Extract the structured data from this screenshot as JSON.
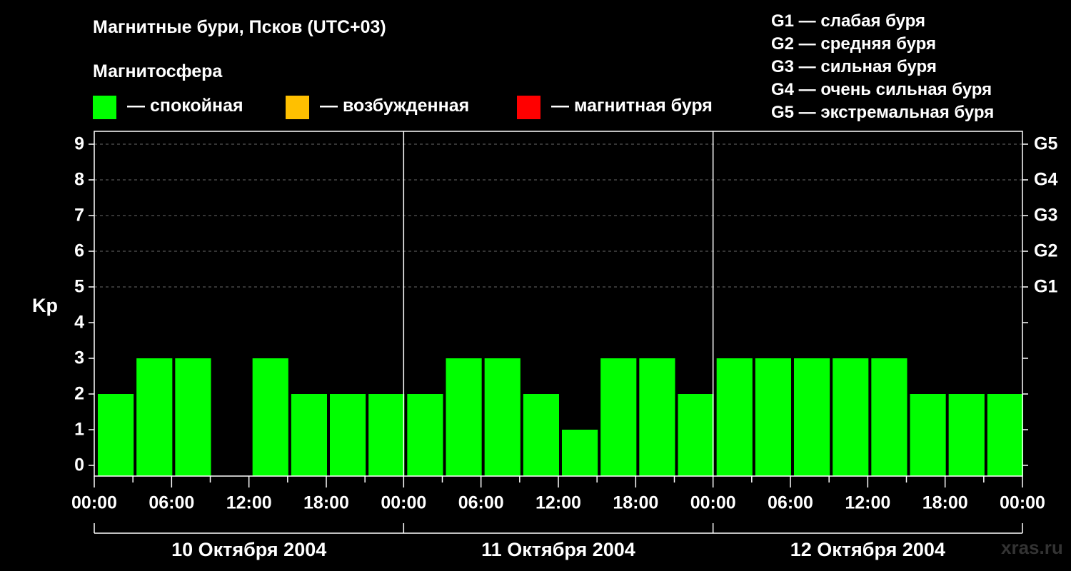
{
  "header": {
    "title": "Магнитные бури, Псков (UTC+03)",
    "subtitle": "Магнитосфера"
  },
  "legend": [
    {
      "color": "#00ff00",
      "label": "— спокойная"
    },
    {
      "color": "#ffc000",
      "label": "— возбужденная"
    },
    {
      "color": "#ff0000",
      "label": "— магнитная буря"
    }
  ],
  "storm_scale": [
    "G1 — слабая буря",
    "G2 — средняя буря",
    "G3 — сильная буря",
    "G4 — очень сильная буря",
    "G5 — экстремальная буря"
  ],
  "credit": "xras.ru",
  "chart_data": {
    "type": "bar",
    "title": "Магнитные бури, Псков (UTC+03)",
    "ylabel": "Kp",
    "ylim": [
      0,
      9
    ],
    "yticks": [
      "0",
      "1",
      "2",
      "3",
      "4",
      "5",
      "6",
      "7",
      "8",
      "9"
    ],
    "right_axis_labels": [
      {
        "kp": 5,
        "label": "G1"
      },
      {
        "kp": 6,
        "label": "G2"
      },
      {
        "kp": 7,
        "label": "G3"
      },
      {
        "kp": 8,
        "label": "G4"
      },
      {
        "kp": 9,
        "label": "G5"
      }
    ],
    "x_tick_labels": [
      "00:00",
      "06:00",
      "12:00",
      "18:00",
      "00:00",
      "06:00",
      "12:00",
      "18:00",
      "00:00",
      "06:00",
      "12:00",
      "18:00",
      "00:00"
    ],
    "days": [
      "10 Октября 2004",
      "11 Октября 2004",
      "12 Октября 2004"
    ],
    "interval_hours": 3,
    "grid": true,
    "series": [
      {
        "values": [
          2,
          3,
          3,
          0,
          3,
          2,
          2,
          2,
          2,
          3,
          3,
          2,
          1,
          3,
          3,
          2,
          3,
          3,
          3,
          3,
          3,
          2,
          2,
          2
        ],
        "colors": [
          "#00ff00",
          "#00ff00",
          "#00ff00",
          "#00ff00",
          "#00ff00",
          "#00ff00",
          "#00ff00",
          "#00ff00",
          "#00ff00",
          "#00ff00",
          "#00ff00",
          "#00ff00",
          "#00ff00",
          "#00ff00",
          "#00ff00",
          "#00ff00",
          "#00ff00",
          "#00ff00",
          "#00ff00",
          "#00ff00",
          "#00ff00",
          "#00ff00",
          "#00ff00",
          "#00ff00"
        ]
      }
    ]
  }
}
